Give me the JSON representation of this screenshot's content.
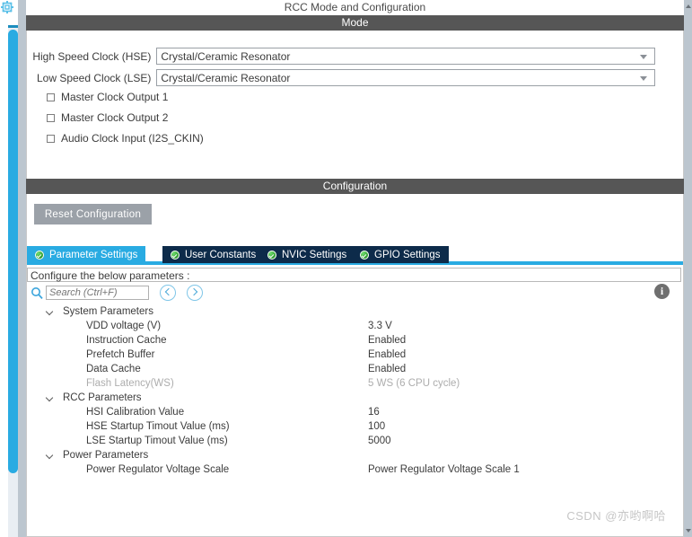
{
  "window": {
    "title": "RCC Mode and Configuration",
    "gear_icon": "gear-icon"
  },
  "mode": {
    "section_title": "Mode",
    "fields": [
      {
        "label": "High Speed Clock (HSE)",
        "value": "Crystal/Ceramic Resonator",
        "caret_icon": "chevron-down-icon"
      },
      {
        "label": "Low Speed Clock (LSE)",
        "value": "Crystal/Ceramic Resonator",
        "caret_icon": "chevron-down-icon"
      }
    ],
    "checkboxes": [
      {
        "label": "Master Clock Output 1",
        "checked": false
      },
      {
        "label": "Master Clock Output 2",
        "checked": false
      },
      {
        "label": "Audio Clock Input (I2S_CKIN)",
        "checked": false
      }
    ]
  },
  "configuration": {
    "section_title": "Configuration",
    "reset_button": "Reset Configuration",
    "tabs": [
      {
        "label": "Parameter Settings",
        "active": true,
        "status_icon": "green-check-icon"
      },
      {
        "label": "User Constants",
        "active": false,
        "status_icon": "green-check-icon"
      },
      {
        "label": "NVIC Settings",
        "active": false,
        "status_icon": "green-check-icon"
      },
      {
        "label": "GPIO Settings",
        "active": false,
        "status_icon": "green-check-icon"
      }
    ],
    "hint": "Configure the below parameters :",
    "search": {
      "placeholder": "Search (Ctrl+F)",
      "value": "",
      "icon": "search-icon",
      "prev_icon": "chevron-left-circle-icon",
      "next_icon": "chevron-right-circle-icon"
    },
    "info_icon_label": "i",
    "tree": [
      {
        "type": "group",
        "name": "System Parameters",
        "expanded": true,
        "children": [
          {
            "name": "VDD voltage (V)",
            "value": "3.3 V",
            "dimmed": false
          },
          {
            "name": "Instruction Cache",
            "value": "Enabled",
            "dimmed": false
          },
          {
            "name": "Prefetch Buffer",
            "value": "Enabled",
            "dimmed": false
          },
          {
            "name": "Data Cache",
            "value": "Enabled",
            "dimmed": false
          },
          {
            "name": "Flash Latency(WS)",
            "value": "5 WS (6 CPU cycle)",
            "dimmed": true
          }
        ]
      },
      {
        "type": "group",
        "name": "RCC Parameters",
        "expanded": true,
        "children": [
          {
            "name": "HSI Calibration Value",
            "value": "16",
            "dimmed": false
          },
          {
            "name": "HSE Startup Timout Value (ms)",
            "value": "100",
            "dimmed": false
          },
          {
            "name": "LSE Startup Timout Value (ms)",
            "value": "5000",
            "dimmed": false
          }
        ]
      },
      {
        "type": "group",
        "name": "Power Parameters",
        "expanded": true,
        "children": [
          {
            "name": "Power Regulator Voltage Scale",
            "value": "Power Regulator Voltage Scale 1",
            "dimmed": false
          }
        ]
      }
    ]
  },
  "watermark": "CSDN @亦哟啊哈",
  "colors": {
    "section_bar": "#565656",
    "accent_blue": "#29abe2",
    "tab_inactive": "#0d2b4a",
    "reset_button": "#9ba1a8",
    "text": "#3c3c3c",
    "dim_text": "#adadad"
  }
}
